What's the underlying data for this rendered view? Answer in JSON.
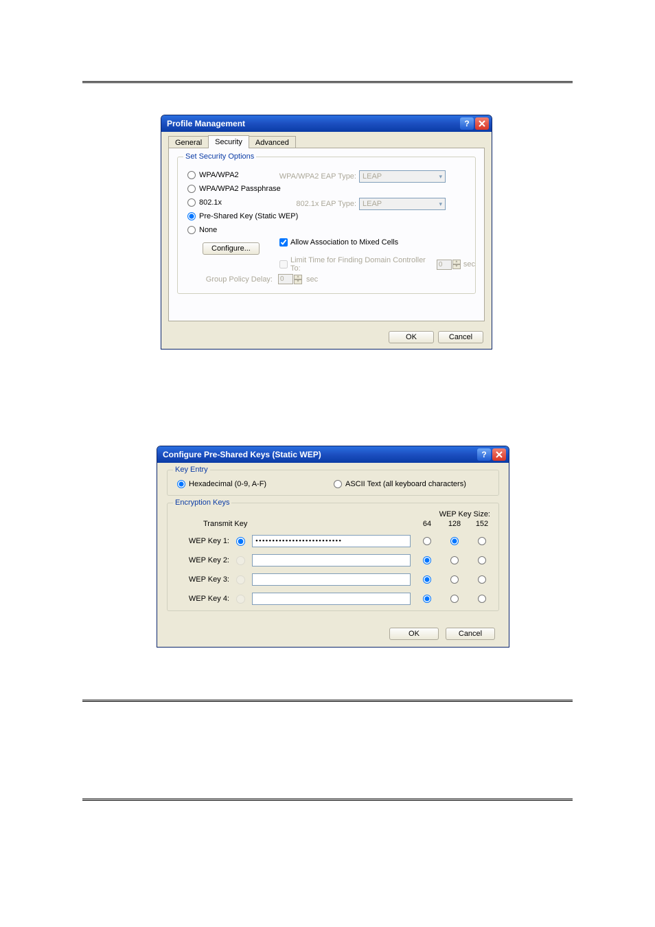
{
  "profile_dialog": {
    "title": "Profile Management",
    "tabs": {
      "general": "General",
      "security": "Security",
      "advanced": "Advanced"
    },
    "group_label": "Set Security Options",
    "radios": {
      "wpa": "WPA/WPA2",
      "wpa_pass": "WPA/WPA2 Passphrase",
      "dot1x": "802.1x",
      "psk": "Pre-Shared Key (Static WEP)",
      "none": "None"
    },
    "configure_btn": "Configure...",
    "eap1_label": "WPA/WPA2 EAP Type:",
    "eap1_value": "LEAP",
    "eap2_label": "802.1x EAP Type:",
    "eap2_value": "LEAP",
    "chk_mixed": "Allow Association to Mixed Cells",
    "chk_limit": "Limit Time for Finding Domain Controller To:",
    "limit_value": "0",
    "limit_unit": "sec",
    "gpd_label": "Group Policy Delay:",
    "gpd_value": "0",
    "gpd_unit": "sec",
    "ok": "OK",
    "cancel": "Cancel"
  },
  "wep_dialog": {
    "title": "Configure Pre-Shared Keys (Static WEP)",
    "key_entry_legend": "Key Entry",
    "hex_label": "Hexadecimal (0-9, A-F)",
    "ascii_label": "ASCII Text (all keyboard characters)",
    "enc_legend": "Encryption Keys",
    "transmit_hdr": "Transmit Key",
    "size_hdr": "WEP Key Size:",
    "size64": "64",
    "size128": "128",
    "size152": "152",
    "rows": [
      {
        "label": "WEP Key 1:",
        "value": "••••••••••••••••••••••••••",
        "tx": true,
        "size": "128",
        "enabled": true
      },
      {
        "label": "WEP Key 2:",
        "value": "",
        "tx": false,
        "size": "64",
        "enabled": false
      },
      {
        "label": "WEP Key 3:",
        "value": "",
        "tx": false,
        "size": "64",
        "enabled": false
      },
      {
        "label": "WEP Key 4:",
        "value": "",
        "tx": false,
        "size": "64",
        "enabled": false
      }
    ],
    "ok": "OK",
    "cancel": "Cancel"
  }
}
